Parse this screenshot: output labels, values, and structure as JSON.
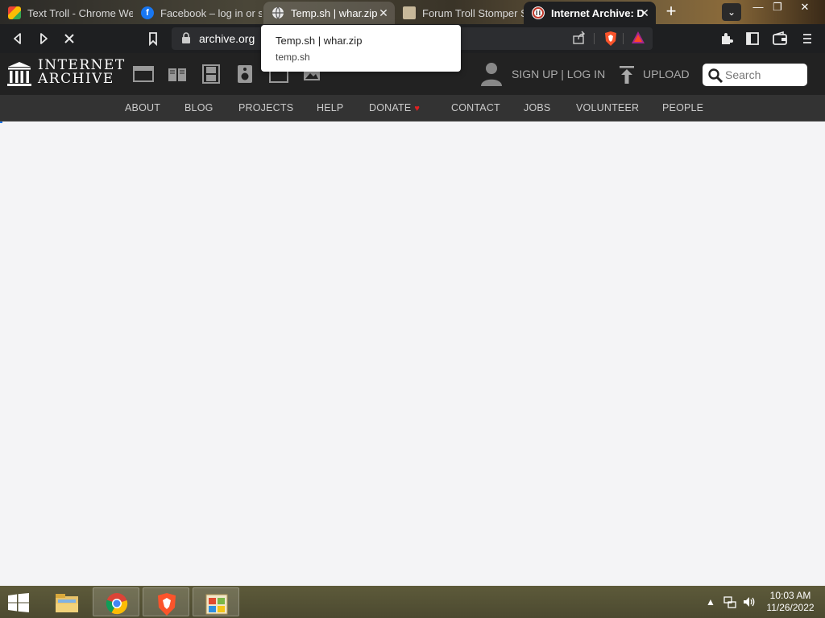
{
  "browser": {
    "tabs": [
      {
        "title": "Text Troll - Chrome We",
        "icon": "chrome-web-store-icon",
        "state": "normal"
      },
      {
        "title": "Facebook – log in or si",
        "icon": "facebook-icon",
        "state": "normal"
      },
      {
        "title": "Temp.sh | whar.zip",
        "icon": "globe-icon",
        "state": "hover",
        "close": "✕"
      },
      {
        "title": "Forum Troll Stomper Se",
        "icon": "document-icon",
        "state": "normal"
      },
      {
        "title": "Internet Archive: D",
        "icon": "internet-archive-icon",
        "state": "active",
        "close": "✕"
      }
    ],
    "new_tab": "+",
    "url": "archive.org",
    "tooltip": {
      "title": "Temp.sh | whar.zip",
      "subtitle": "temp.sh"
    },
    "window_controls": {
      "minimize": "—",
      "restore": "❐",
      "close": "✕"
    }
  },
  "site": {
    "wordmark_line1": "INTERNET",
    "wordmark_line2": "ARCHIVE",
    "signup_login": "SIGN UP | LOG IN",
    "upload": "UPLOAD",
    "search_placeholder": "Search",
    "nav": [
      "ABOUT",
      "BLOG",
      "PROJECTS",
      "HELP",
      "DONATE",
      "CONTACT",
      "JOBS",
      "VOLUNTEER",
      "PEOPLE"
    ],
    "donate_heart": "♥",
    "accent_heart": "#e02020"
  },
  "taskbar": {
    "time": "10:03 AM",
    "date": "11/26/2022",
    "apps": [
      "file-explorer-icon",
      "chrome-icon",
      "brave-icon",
      "windows-store-icon"
    ]
  }
}
